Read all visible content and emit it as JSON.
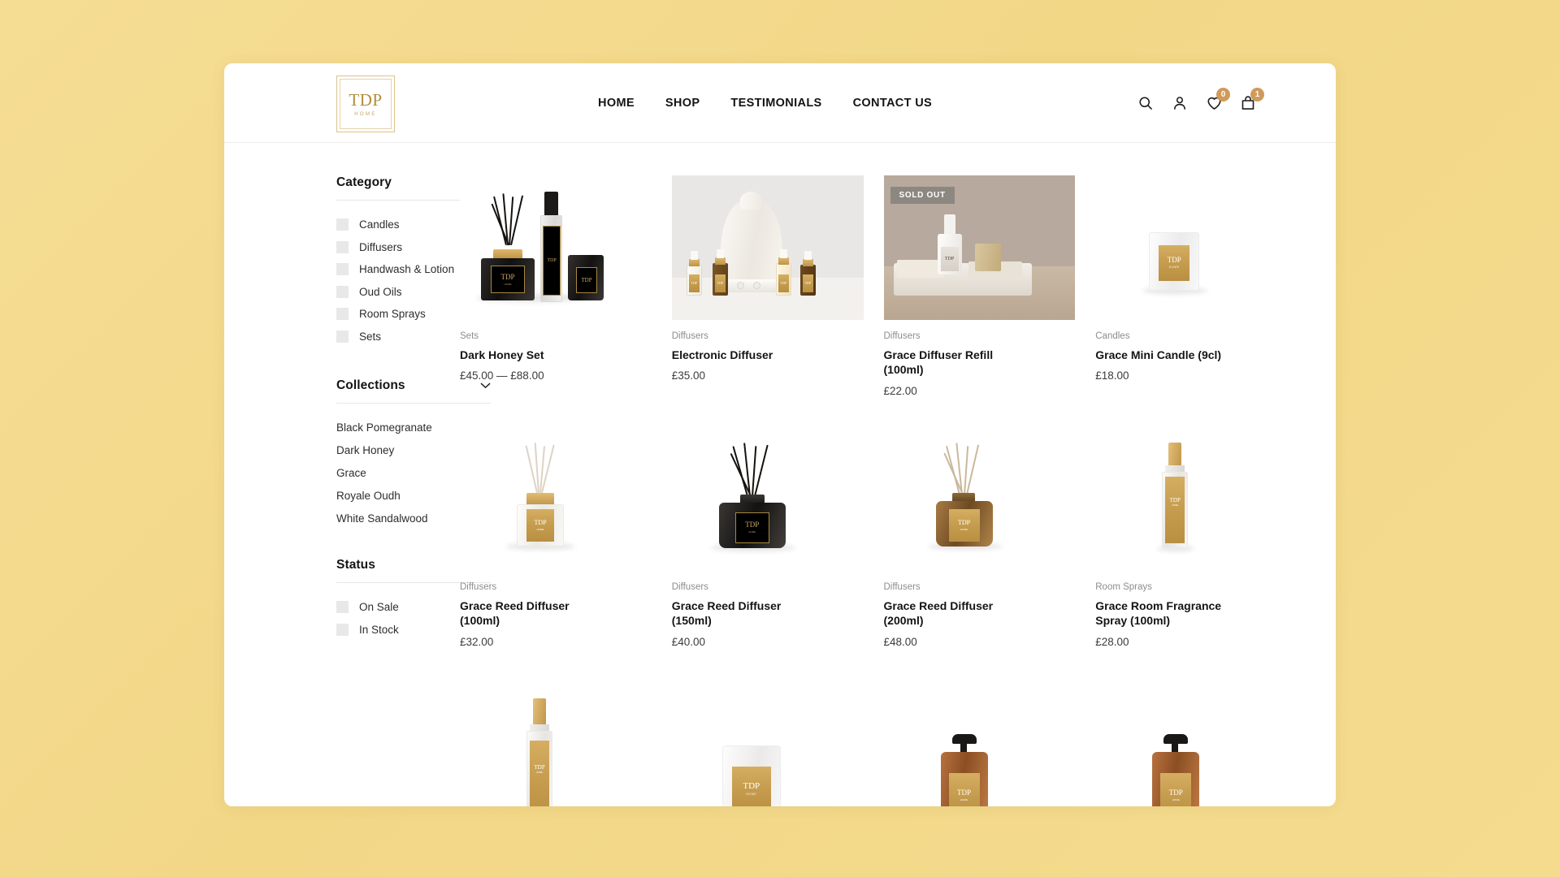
{
  "brand": {
    "logo_main": "TDP",
    "logo_sub": "HOME"
  },
  "nav": {
    "items": [
      {
        "label": "HOME"
      },
      {
        "label": "SHOP"
      },
      {
        "label": "TESTIMONIALS"
      },
      {
        "label": "CONTACT US"
      }
    ]
  },
  "header_icons": {
    "search": "search-icon",
    "account": "user-icon",
    "wishlist": "heart-icon",
    "wishlist_count": "0",
    "cart": "bag-icon",
    "cart_count": "1",
    "badge_color": "#cf9a5b"
  },
  "sidebar": {
    "filters": [
      {
        "title": "Category",
        "type": "checkbox",
        "options": [
          {
            "label": "Candles",
            "checked": false
          },
          {
            "label": "Diffusers",
            "checked": false
          },
          {
            "label": "Handwash & Lotion",
            "checked": false
          },
          {
            "label": "Oud Oils",
            "checked": false
          },
          {
            "label": "Room Sprays",
            "checked": false
          },
          {
            "label": "Sets",
            "checked": false
          }
        ]
      },
      {
        "title": "Collections",
        "type": "link",
        "options": [
          {
            "label": "Black Pomegranate"
          },
          {
            "label": "Dark Honey"
          },
          {
            "label": "Grace"
          },
          {
            "label": "Royale Oudh"
          },
          {
            "label": "White Sandalwood"
          }
        ]
      },
      {
        "title": "Status",
        "type": "checkbox",
        "options": [
          {
            "label": "On Sale",
            "checked": false
          },
          {
            "label": "In Stock",
            "checked": false
          }
        ]
      }
    ]
  },
  "products": [
    {
      "category": "Sets",
      "name": "Dark Honey Set",
      "price": "£45.00 — £88.00",
      "badge": "",
      "art": "set-dark-honey",
      "bg": "white"
    },
    {
      "category": "Diffusers",
      "name": "Electronic Diffuser",
      "price": "£35.00",
      "badge": "",
      "art": "electronic-diffuser",
      "bg": "grey"
    },
    {
      "category": "Diffusers",
      "name": "Grace Diffuser Refill (100ml)",
      "price": "£22.00",
      "badge": "SOLD OUT",
      "art": "diffuser-refill",
      "bg": "taupe"
    },
    {
      "category": "Candles",
      "name": "Grace Mini Candle (9cl)",
      "price": "£18.00",
      "badge": "",
      "art": "mini-candle",
      "bg": "white"
    },
    {
      "category": "Diffusers",
      "name": "Grace Reed Diffuser (100ml)",
      "price": "£32.00",
      "badge": "",
      "art": "reed-clear",
      "bg": "white"
    },
    {
      "category": "Diffusers",
      "name": "Grace Reed Diffuser (150ml)",
      "price": "£40.00",
      "badge": "",
      "art": "reed-black",
      "bg": "white"
    },
    {
      "category": "Diffusers",
      "name": "Grace Reed Diffuser (200ml)",
      "price": "£48.00",
      "badge": "",
      "art": "reed-amber",
      "bg": "white"
    },
    {
      "category": "Room Sprays",
      "name": "Grace Room Fragrance Spray (100ml)",
      "price": "£28.00",
      "badge": "",
      "art": "room-spray",
      "bg": "white"
    }
  ],
  "products_partial": [
    {
      "art": "room-spray-tall"
    },
    {
      "art": "white-candle"
    },
    {
      "art": "pump-bottle"
    },
    {
      "art": "pump-bottle"
    }
  ],
  "colors": {
    "page_background": "#f2d787",
    "card_background": "#ffffff",
    "gold": "#c49a4c",
    "text": "#141414",
    "muted": "#8d8d8d"
  }
}
